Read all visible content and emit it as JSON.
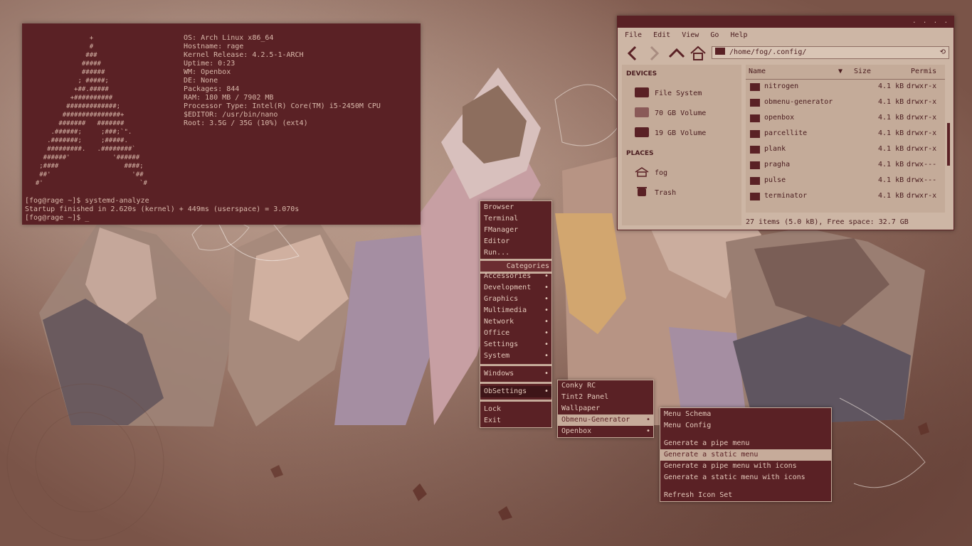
{
  "colors": {
    "accent": "#5a2125",
    "text_light": "#e4c9bb",
    "panel": "#cdb6a5",
    "highlight": "#c6ab9a"
  },
  "terminal": {
    "logo": [
      "                +",
      "                #",
      "               ###",
      "              #####",
      "              ######",
      "             ; #####;",
      "            +##.#####",
      "           +##########",
      "          #############;",
      "         ###############+",
      "        #######   #######",
      "      .######;     ;###;`\".",
      "     .#######;     ;#####.",
      "     #########.   .########`",
      "    ######'           '######",
      "   ;####                 ####;",
      "   ##'                     '##",
      "  #'                         `#"
    ],
    "info": [
      "OS: Arch Linux x86_64",
      "Hostname: rage",
      "Kernel Release: 4.2.5-1-ARCH",
      "Uptime: 0:23",
      "WM: Openbox",
      "DE: None",
      "Packages: 844",
      "RAM: 180 MB / 7902 MB",
      "Processor Type: Intel(R) Core(TM) i5-2450M CPU",
      "$EDITOR: /usr/bin/nano",
      "Root: 3.5G / 35G (10%) (ext4)"
    ],
    "lines": [
      "[fog@rage ~]$ systemd-analyze",
      "Startup finished in 2.620s (kernel) + 449ms (userspace) = 3.070s",
      "[fog@rage ~]$ _"
    ]
  },
  "filemanager": {
    "window_controls": ". . . .",
    "menu": [
      "File",
      "Edit",
      "View",
      "Go",
      "Help"
    ],
    "path": "/home/fog/.config/",
    "devices_header": "DEVICES",
    "devices": [
      "File System",
      "70 GB Volume",
      "19 GB Volume"
    ],
    "places_header": "PLACES",
    "places": [
      "fog",
      "Trash"
    ],
    "columns": {
      "name": "Name",
      "size": "Size",
      "perms": "Permis"
    },
    "rows": [
      {
        "name": "nitrogen",
        "size": "4.1 kB",
        "perms": "drwxr-x"
      },
      {
        "name": "obmenu-generator",
        "size": "4.1 kB",
        "perms": "drwxr-x"
      },
      {
        "name": "openbox",
        "size": "4.1 kB",
        "perms": "drwxr-x"
      },
      {
        "name": "parcellite",
        "size": "4.1 kB",
        "perms": "drwxr-x"
      },
      {
        "name": "plank",
        "size": "4.1 kB",
        "perms": "drwxr-x"
      },
      {
        "name": "pragha",
        "size": "4.1 kB",
        "perms": "drwx---"
      },
      {
        "name": "pulse",
        "size": "4.1 kB",
        "perms": "drwx---"
      },
      {
        "name": "terminator",
        "size": "4.1 kB",
        "perms": "drwxr-x"
      }
    ],
    "status": "27 items (5.0 kB), Free space: 32.7 GB"
  },
  "root_menu": {
    "apps": [
      "Browser",
      "Terminal",
      "FManager",
      "Editor",
      "Run..."
    ],
    "categories_header": "Categories",
    "categories": [
      "Accessories",
      "Development",
      "Graphics",
      "Multimedia",
      "Network",
      "Office",
      "Settings",
      "System"
    ],
    "windows": "Windows",
    "obsettings": "ObSettings",
    "lock": "Lock",
    "exit": "Exit",
    "arrow": "•"
  },
  "obsettings_menu": {
    "items": [
      "Conky RC",
      "Tint2 Panel",
      "Wallpaper",
      "Obmenu-Generator",
      "Openbox"
    ],
    "arrow": "•"
  },
  "obmenu_menu": {
    "items": [
      "Menu Schema",
      "Menu Config",
      "Generate a pipe menu",
      "Generate a static menu",
      "Generate a pipe menu with icons",
      "Generate a static menu with icons",
      "Refresh Icon Set"
    ]
  }
}
